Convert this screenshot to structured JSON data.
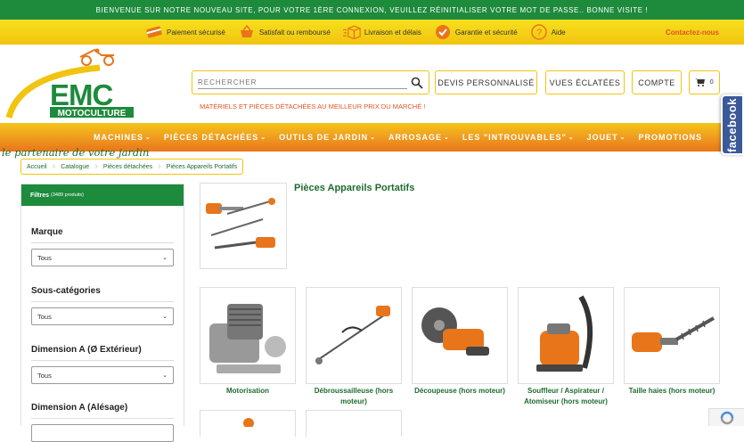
{
  "topbar": {
    "message": "BIENVENUE SUR NOTRE NOUVEAU SITE, POUR VOTRE 1ÈRE CONNEXION, VEUILLEZ RÉINITIALISER VOTRE MOT DE PASSE.. BONNE VISITE !"
  },
  "infobar": {
    "items": [
      {
        "label": "Paiement sécurisé",
        "icon": "credit-card-icon"
      },
      {
        "label": "Satisfait ou remboursé",
        "icon": "basket-icon"
      },
      {
        "label": "Livraison et délais",
        "icon": "box-icon"
      },
      {
        "label": "Garantie et sécurité",
        "icon": "badge-icon"
      },
      {
        "label": "Aide",
        "icon": "help-icon"
      }
    ],
    "contact": "Contactez-nous"
  },
  "logo": {
    "brand": "EMC",
    "sub": "MOTOCULTURE",
    "slogan": "le partenaire de votre jardin"
  },
  "search": {
    "placeholder": "RECHERCHER"
  },
  "header_buttons": {
    "devis": "DEVIS PERSONNALISÉ",
    "vues": "VUES ÉCLATÉES",
    "compte": "COMPTE",
    "cart_count": "0"
  },
  "tagline": "MATÉRIELS ET PIÈCES DÉTACHÉES AU MEILLEUR PRIX DU MARCHÉ !",
  "facebook": "facebook",
  "nav": [
    {
      "label": "MACHINES",
      "chev": "⌄"
    },
    {
      "label": "PIÈCES DÉTACHÉES",
      "chev": "⌄"
    },
    {
      "label": "OUTILS DE JARDIN",
      "chev": "⌄"
    },
    {
      "label": "ARROSAGE",
      "chev": "⌄"
    },
    {
      "label": "LES \"INTROUVABLES\"",
      "chev": "⌄"
    },
    {
      "label": "JOUET",
      "chev": "⌄"
    },
    {
      "label": "PROMOTIONS",
      "chev": ""
    }
  ],
  "breadcrumb": [
    "Accueil",
    "Catalogue",
    "Pièces détachées",
    "Pièces Appareils Portatifs"
  ],
  "filters": {
    "title": "Filtres",
    "count": "(3489 produits)",
    "groups": [
      {
        "label": "Marque",
        "value": "Tous"
      },
      {
        "label": "Sous-catégories",
        "value": "Tous"
      },
      {
        "label": "Dimension A (Ø Extérieur)",
        "value": "Tous"
      },
      {
        "label": "Dimension A (Alésage)",
        "value": ""
      }
    ]
  },
  "main": {
    "title": "Pièces Appareils Portatifs",
    "categories": [
      {
        "label": "Motorisation"
      },
      {
        "label": "Débroussailleuse (hors moteur)"
      },
      {
        "label": "Découpeuse (hors moteur)"
      },
      {
        "label": "Souffleur / Aspirateur / Atomiseur (hors moteur)"
      },
      {
        "label": "Taille haies (hors moteur)"
      }
    ]
  },
  "colors": {
    "green": "#1e8a3c",
    "yellow": "#f1c40f",
    "orange": "#e8751a",
    "accent": "#e2531f"
  }
}
